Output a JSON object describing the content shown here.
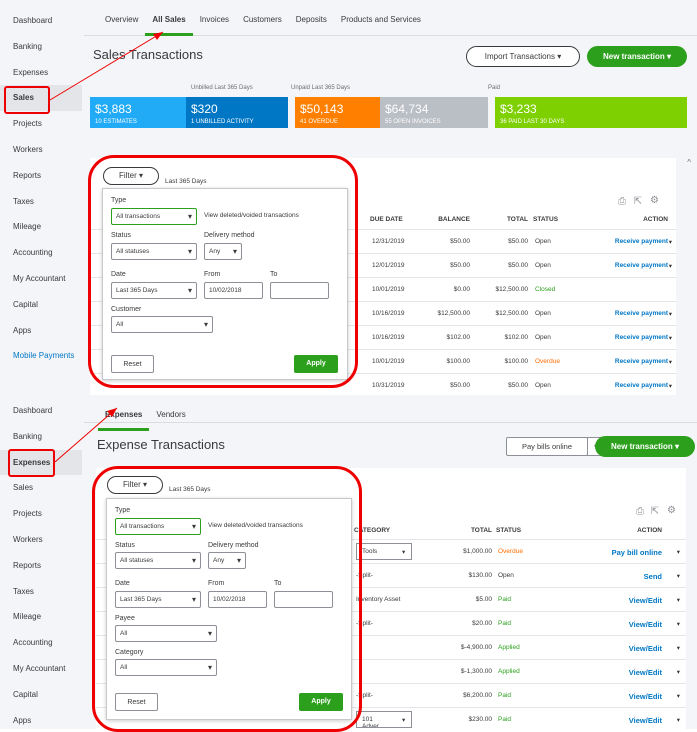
{
  "sales": {
    "sidebar": [
      "Dashboard",
      "Banking",
      "Expenses",
      "Sales",
      "Projects",
      "Workers",
      "Reports",
      "Taxes",
      "Mileage",
      "Accounting",
      "My Accountant",
      "Capital",
      "Apps",
      "Mobile Payments"
    ],
    "tabs": [
      "Overview",
      "All Sales",
      "Invoices",
      "Customers",
      "Deposits",
      "Products and Services"
    ],
    "title": "Sales Transactions",
    "import_button": "Import Transactions",
    "new_button": "New transaction",
    "money_labels": {
      "unbilled": "Unbilled Last 365 Days",
      "unpaid": "Unpaid Last 365 Days",
      "paid": "Paid"
    },
    "money": [
      {
        "amount": "$3,883",
        "label": "10 ESTIMATES",
        "color": "#21abf6"
      },
      {
        "amount": "$320",
        "label": "1 UNBILLED ACTIVITY",
        "color": "#0077c5"
      },
      {
        "amount": "$50,143",
        "label": "41 OVERDUE",
        "color": "#ff8000"
      },
      {
        "amount": "$64,734",
        "label": "55 OPEN INVOICES",
        "color": "#babec5"
      },
      {
        "amount": "$3,233",
        "label": "36 PAID LAST 30 DAYS",
        "color": "#7fd000"
      }
    ],
    "filter": {
      "button": "Filter",
      "range": "Last 365 Days",
      "type_label": "Type",
      "type": "All transactions",
      "view_deleted": "View deleted/voided transactions",
      "status_label": "Status",
      "status": "All statuses",
      "delivery_label": "Delivery method",
      "delivery": "Any",
      "date_label": "Date",
      "date": "Last 365 Days",
      "from_label": "From",
      "from": "10/02/2018",
      "to_label": "To",
      "to": "",
      "customer_label": "Customer",
      "customer": "All",
      "reset": "Reset",
      "apply": "Apply"
    },
    "columns": [
      "DUE DATE",
      "BALANCE",
      "TOTAL",
      "STATUS",
      "ACTION"
    ],
    "rows": [
      [
        "12/31/2019",
        "$50.00",
        "$50.00",
        "Open",
        "Receive payment"
      ],
      [
        "12/01/2019",
        "$50.00",
        "$50.00",
        "Open",
        "Receive payment"
      ],
      [
        "10/01/2019",
        "$0.00",
        "$12,500.00",
        "Closed",
        ""
      ],
      [
        "10/16/2019",
        "$12,500.00",
        "$12,500.00",
        "Open",
        "Receive payment"
      ],
      [
        "10/16/2019",
        "$102.00",
        "$102.00",
        "Open",
        "Receive payment"
      ],
      [
        "10/01/2019",
        "$100.00",
        "$100.00",
        "Overdue",
        "Receive payment"
      ],
      [
        "10/31/2019",
        "$50.00",
        "$50.00",
        "Open",
        "Receive payment"
      ]
    ]
  },
  "expenses": {
    "sidebar": [
      "Dashboard",
      "Banking",
      "Expenses",
      "Sales",
      "Projects",
      "Workers",
      "Reports",
      "Taxes",
      "Mileage",
      "Accounting",
      "My Accountant",
      "Capital",
      "Apps"
    ],
    "tabs": [
      "Expenses",
      "Vendors"
    ],
    "title": "Expense Transactions",
    "pay_button": "Pay bills online",
    "new_button": "New transaction",
    "filter": {
      "button": "Filter",
      "range": "Last 365 Days",
      "type_label": "Type",
      "type": "All transactions",
      "view_deleted": "View deleted/voided transactions",
      "status_label": "Status",
      "status": "All statuses",
      "delivery_label": "Delivery method",
      "delivery": "Any",
      "date_label": "Date",
      "date": "Last 365 Days",
      "from_label": "From",
      "from": "10/02/2018",
      "to_label": "To",
      "to": "",
      "payee_label": "Payee",
      "payee": "All",
      "category_label": "Category",
      "category": "All",
      "reset": "Reset",
      "apply": "Apply"
    },
    "columns": [
      "CATEGORY",
      "TOTAL",
      "STATUS",
      "ACTION"
    ],
    "rows": [
      [
        "Tools",
        "$1,000.00",
        "Overdue",
        "Pay bill online",
        "select"
      ],
      [
        "-Split-",
        "$130.00",
        "Open",
        "Send",
        ""
      ],
      [
        "Inventory Asset",
        "$5.00",
        "Paid",
        "View/Edit",
        ""
      ],
      [
        "-Split-",
        "$20.00",
        "Paid",
        "View/Edit",
        ""
      ],
      [
        "",
        "$-4,900.00",
        "Applied",
        "View/Edit",
        ""
      ],
      [
        "",
        "$-1,300.00",
        "Applied",
        "View/Edit",
        ""
      ],
      [
        "-Split-",
        "$6,200.00",
        "Paid",
        "View/Edit",
        ""
      ],
      [
        "101 Adver",
        "$230.00",
        "Paid",
        "View/Edit",
        "select"
      ]
    ]
  },
  "status_colors": {
    "Open": "#393a3d",
    "Closed": "#2ca01c",
    "Overdue": "#ff6a00",
    "Paid": "#2ca01c",
    "Applied": "#2ca01c"
  }
}
